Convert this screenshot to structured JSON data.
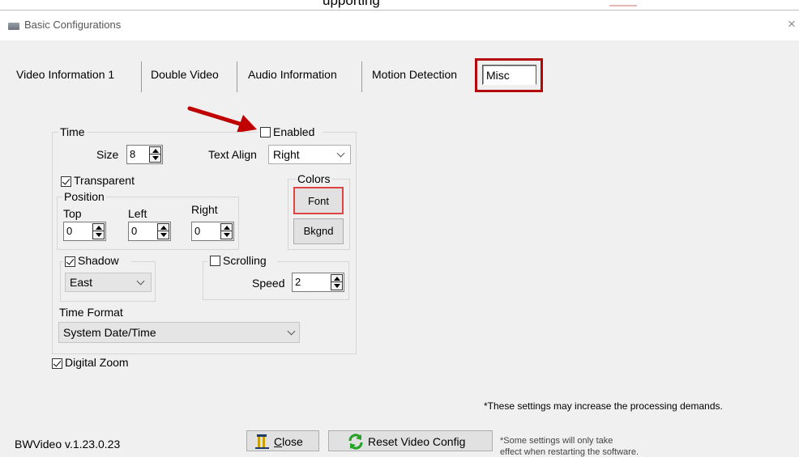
{
  "header_partial": "upporting",
  "window": {
    "title": "Basic Configurations",
    "close_glyph": "×",
    "icon": "window-app-icon"
  },
  "tabs": [
    {
      "label": "Video Information 1"
    },
    {
      "label": "Double Video"
    },
    {
      "label": "Audio Information"
    },
    {
      "label": "Motion Detection"
    },
    {
      "label": "Misc",
      "selected": true
    }
  ],
  "time_group": {
    "label": "Time",
    "enabled": {
      "label": "Enabled",
      "checked": false
    },
    "size": {
      "label": "Size",
      "value": "8"
    },
    "text_align": {
      "label": "Text Align",
      "value": "Right"
    },
    "transparent": {
      "label": "Transparent",
      "checked": true
    },
    "colors": {
      "label": "Colors",
      "font_button": "Font",
      "bkgnd_button": "Bkgnd"
    },
    "position": {
      "label": "Position",
      "top": {
        "label": "Top",
        "value": "0"
      },
      "left": {
        "label": "Left",
        "value": "0"
      },
      "right": {
        "label": "Right",
        "value": "0"
      }
    },
    "shadow": {
      "label": "Shadow",
      "checked": true,
      "value": "East"
    },
    "scrolling": {
      "label": "Scrolling",
      "checked": false,
      "speed_label": "Speed",
      "speed_value": "2"
    },
    "time_format": {
      "label": "Time Format",
      "value": "System Date/Time"
    }
  },
  "digital_zoom": {
    "label": "Digital Zoom",
    "checked": true
  },
  "notes": {
    "processing": "*These settings may increase the processing demands.",
    "restart_line1": "*Some settings will only take",
    "restart_line2": "effect when restarting the software."
  },
  "footer": {
    "version": "BWVideo v.1.23.0.23",
    "close_button": "Close",
    "close_mnemonic": "C",
    "close_rest": "lose",
    "reset_button": "Reset Video Config"
  },
  "colors": {
    "highlight_red": "#b3070b",
    "arrow_red": "#c00000"
  }
}
